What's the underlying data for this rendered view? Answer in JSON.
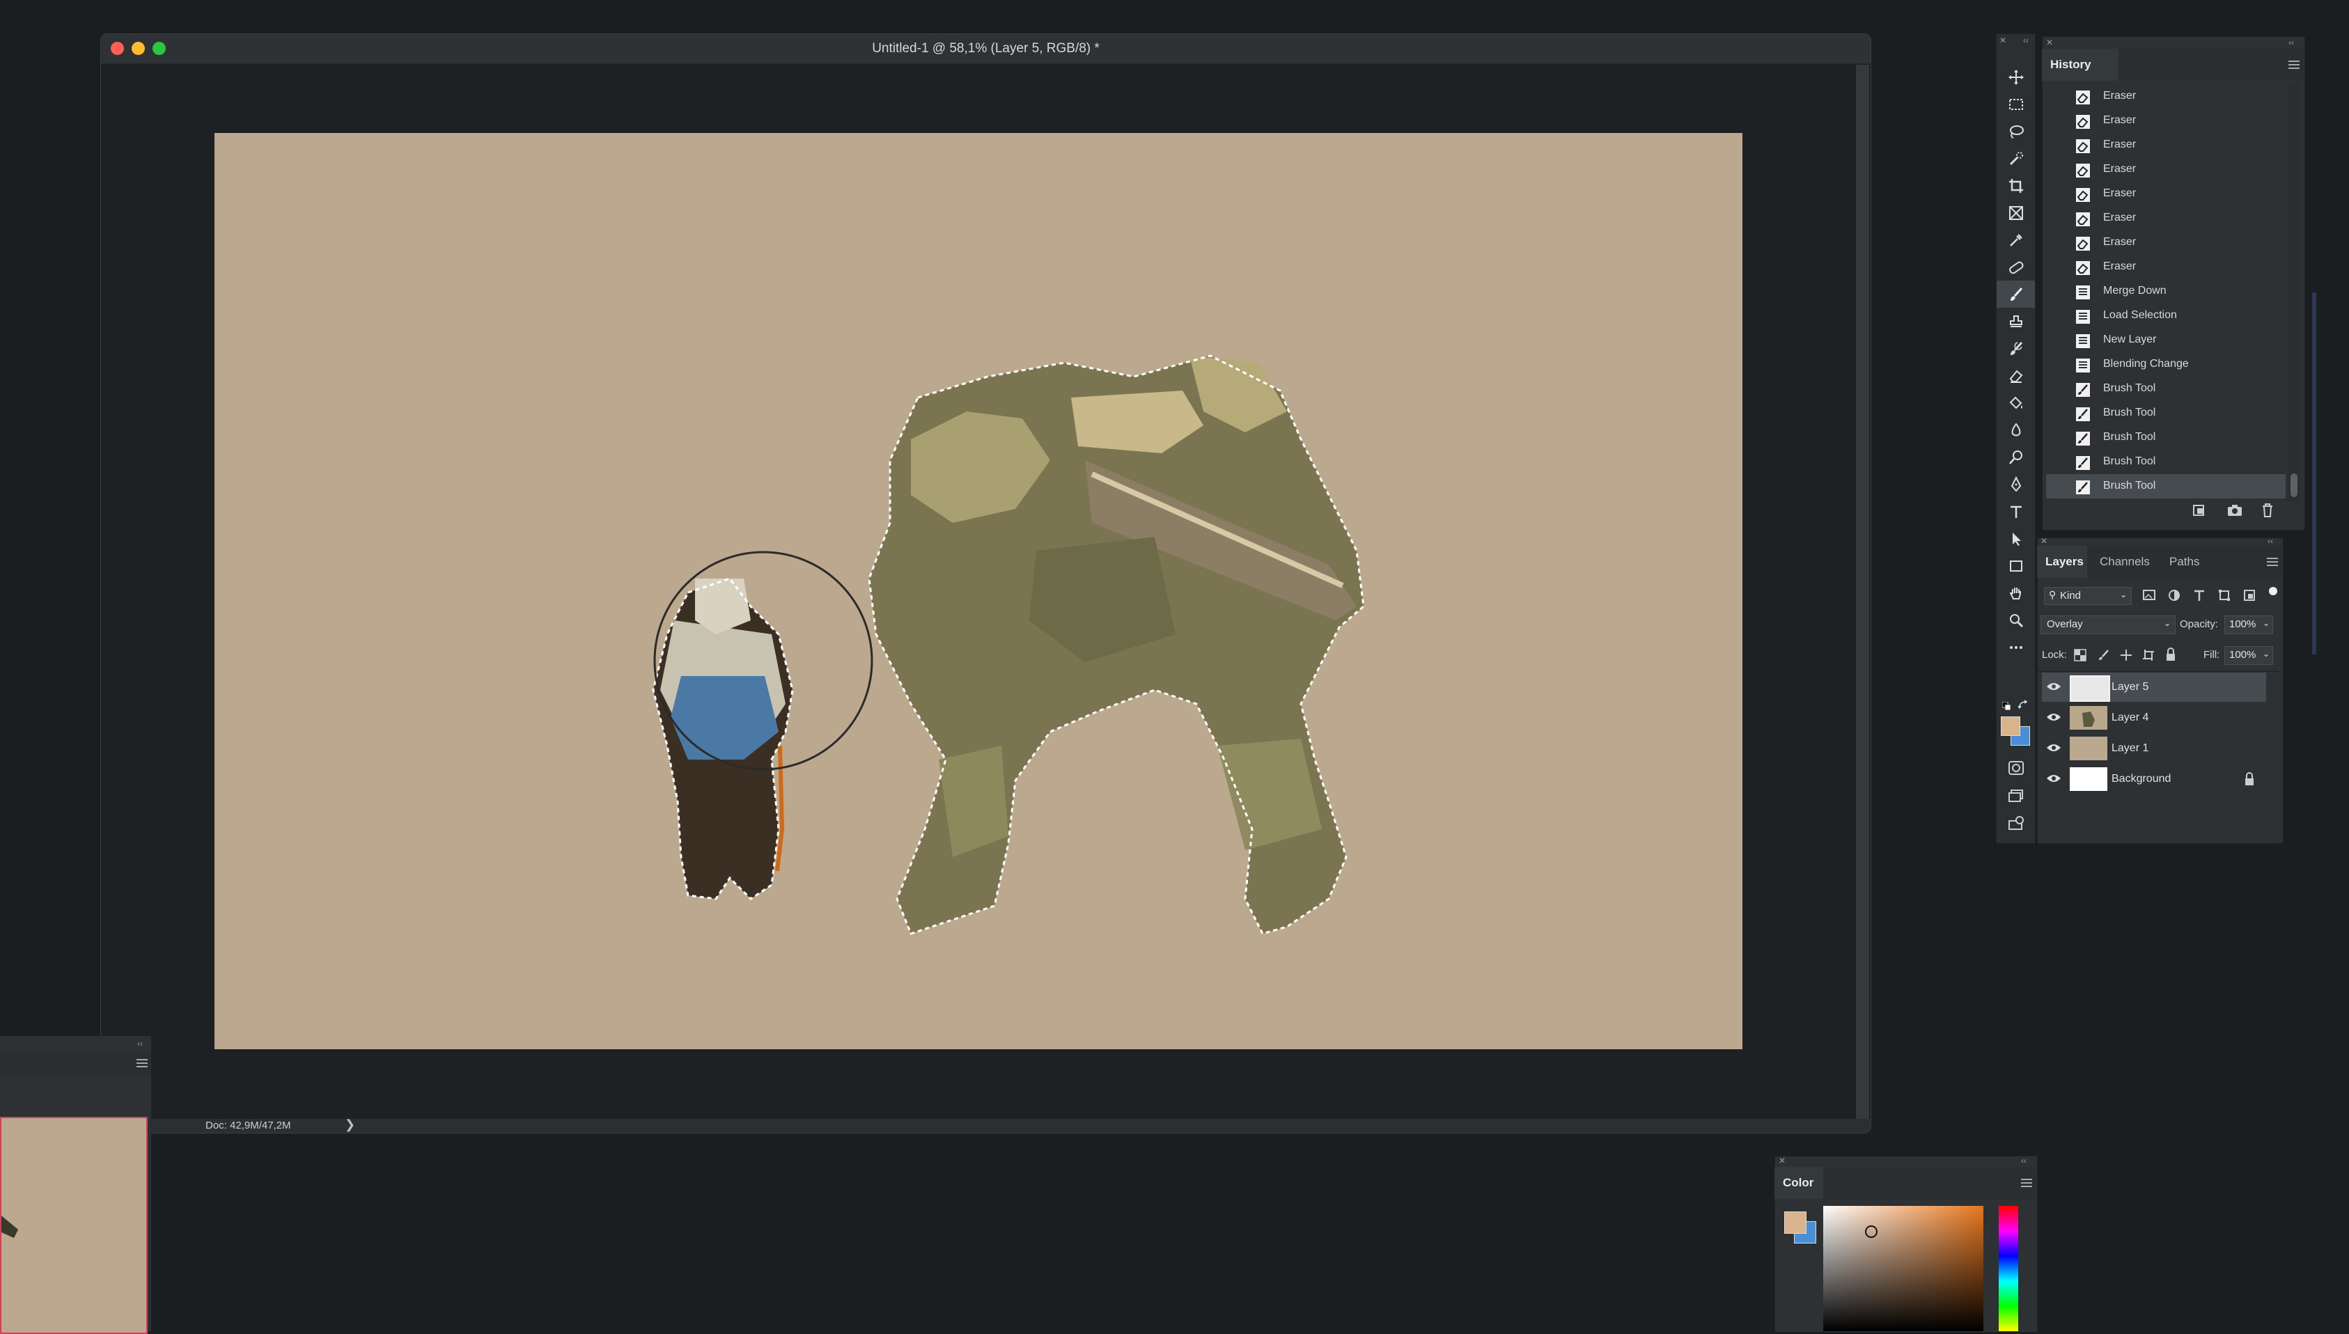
{
  "document": {
    "title": "Untitled-1 @ 58,1% (Layer 5, RGB/8) *",
    "status": "Doc: 42,9M/47,2M",
    "status_arrow": "❯",
    "canvas_color": "#bba88e"
  },
  "tools": [
    "move-tool",
    "marquee-tool",
    "lasso-tool",
    "quick-selection-tool",
    "crop-tool",
    "frame-tool",
    "eyedropper-tool",
    "spot-healing-tool",
    "brush-tool",
    "clone-stamp-tool",
    "history-brush-tool",
    "eraser-tool",
    "paint-bucket-tool",
    "blur-tool",
    "dodge-tool",
    "pen-tool",
    "type-tool",
    "path-selection-tool",
    "rectangle-tool",
    "hand-tool",
    "zoom-tool",
    "more-tools"
  ],
  "history": {
    "tab": "History",
    "items": [
      {
        "label": "Eraser",
        "icon": "eraser-icon"
      },
      {
        "label": "Eraser",
        "icon": "eraser-icon"
      },
      {
        "label": "Eraser",
        "icon": "eraser-icon"
      },
      {
        "label": "Eraser",
        "icon": "eraser-icon"
      },
      {
        "label": "Eraser",
        "icon": "eraser-icon"
      },
      {
        "label": "Eraser",
        "icon": "eraser-icon"
      },
      {
        "label": "Eraser",
        "icon": "eraser-icon"
      },
      {
        "label": "Eraser",
        "icon": "eraser-icon"
      },
      {
        "label": "Merge Down",
        "icon": "document-icon"
      },
      {
        "label": "Load Selection",
        "icon": "document-icon"
      },
      {
        "label": "New Layer",
        "icon": "document-icon"
      },
      {
        "label": "Blending Change",
        "icon": "document-icon"
      },
      {
        "label": "Brush Tool",
        "icon": "brush-icon"
      },
      {
        "label": "Brush Tool",
        "icon": "brush-icon"
      },
      {
        "label": "Brush Tool",
        "icon": "brush-icon"
      },
      {
        "label": "Brush Tool",
        "icon": "brush-icon"
      },
      {
        "label": "Brush Tool",
        "icon": "brush-icon"
      }
    ]
  },
  "layers_panel": {
    "tabs": [
      "Layers",
      "Channels",
      "Paths"
    ],
    "filter_kind": "Kind",
    "blend_mode": "Overlay",
    "opacity_label": "Opacity:",
    "opacity": "100%",
    "lock_label": "Lock:",
    "fill_label": "Fill:",
    "fill": "100%",
    "layers": [
      {
        "name": "Layer 5",
        "thumb": "#e8e8e8",
        "selected": true,
        "locked": false
      },
      {
        "name": "Layer 4",
        "thumb": "#b9a78c",
        "selected": false,
        "locked": false
      },
      {
        "name": "Layer 1",
        "thumb": "#bba88e",
        "selected": false,
        "locked": false
      },
      {
        "name": "Background",
        "thumb": "#ffffff",
        "selected": false,
        "locked": true
      }
    ]
  },
  "color_panel": {
    "tab": "Color",
    "foreground": "#d9b38c",
    "background": "#4a8fd6"
  }
}
